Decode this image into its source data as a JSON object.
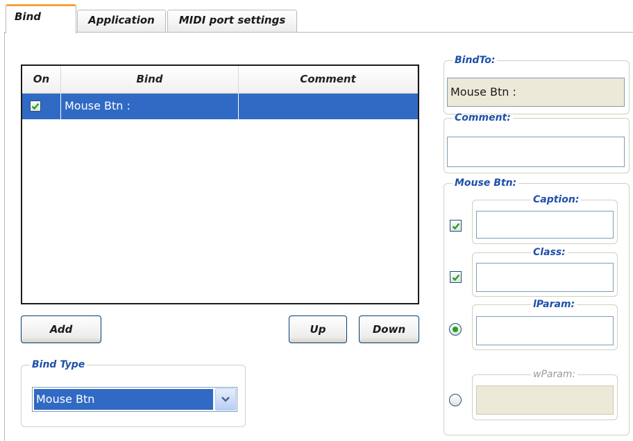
{
  "tabs": [
    {
      "label": "Bind",
      "active": true
    },
    {
      "label": "Application",
      "active": false
    },
    {
      "label": "MIDI port settings",
      "active": false
    }
  ],
  "list": {
    "columns": [
      "On",
      "Bind",
      "Comment"
    ],
    "rows": [
      {
        "on": true,
        "bind": "Mouse Btn :",
        "comment": "",
        "selected": true
      }
    ]
  },
  "buttons": {
    "add": "Add",
    "up": "Up",
    "down": "Down"
  },
  "bind_type": {
    "legend": "Bind Type",
    "selected": "Mouse Btn"
  },
  "bind_to": {
    "legend": "BindTo:",
    "value": "Mouse Btn :"
  },
  "comment": {
    "legend": "Comment:",
    "value": ""
  },
  "mouse_btn": {
    "legend": "Mouse Btn:",
    "caption": {
      "legend": "Caption:",
      "value": "",
      "checked": true
    },
    "class": {
      "legend": "Class:",
      "value": "",
      "checked": true
    },
    "lparam": {
      "legend": "lParam:",
      "value": "",
      "selected": true
    },
    "wparam": {
      "legend": "wParam:",
      "value": "",
      "selected": false,
      "disabled": true
    }
  },
  "colors": {
    "selection": "#316ac5",
    "legend_text": "#1f4fa8",
    "active_tab_accent": "#f3a43b",
    "check_mark": "#21a121"
  }
}
